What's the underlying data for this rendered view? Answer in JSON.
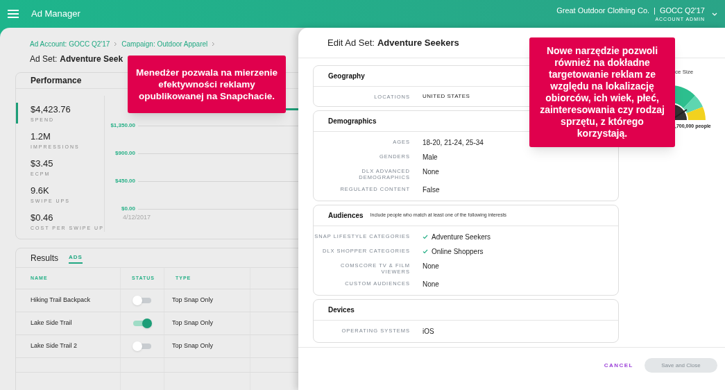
{
  "header": {
    "title": "Ad Manager",
    "account": "Great Outdoor Clothing Co.",
    "separator": "|",
    "campaign_code": "GOCC Q2'17",
    "role": "ACCOUNT ADMIN"
  },
  "breadcrumbs": [
    "Ad Account: GOCC Q2'17",
    "Campaign: Outdoor Apparel"
  ],
  "page_title": {
    "prefix": "Ad Set:",
    "name": "Adventure Seek"
  },
  "performance": {
    "title": "Performance",
    "metrics": [
      {
        "value": "$4,423.76",
        "label": "SPEND",
        "selected": true
      },
      {
        "value": "1.2M",
        "label": "IMPRESSIONS",
        "selected": false
      },
      {
        "value": "$3.45",
        "label": "ECPM",
        "selected": false
      },
      {
        "value": "9.6K",
        "label": "SWIPE UPS",
        "selected": false
      },
      {
        "value": "$0.46",
        "label": "COST PER SWIPE UP",
        "selected": false
      }
    ],
    "y_ticks": [
      "$1,350.00",
      "$900.00",
      "$450.00",
      "$0.00"
    ],
    "x_label": "4/12/2017"
  },
  "results": {
    "title": "Results",
    "tabs": [
      {
        "label": "ADS",
        "selected": true
      }
    ],
    "columns": [
      "NAME",
      "STATUS",
      "TYPE"
    ],
    "rows": [
      {
        "name": "Hiking Trail Backpack",
        "on": false,
        "type": "Top Snap Only"
      },
      {
        "name": "Lake Side Trail",
        "on": true,
        "type": "Top Snap Only"
      },
      {
        "name": "Lake Side Trail 2",
        "on": false,
        "type": "Top Snap Only"
      }
    ]
  },
  "drawer": {
    "title_prefix": "Edit Ad Set:",
    "title_name": "Adventure Seekers",
    "sections": [
      {
        "title": "Geography",
        "rows": [
          {
            "label": "LOCATIONS",
            "value": "UNITED STATES",
            "kind": "caps"
          }
        ]
      },
      {
        "title": "Demographics",
        "rows": [
          {
            "label": "AGES",
            "value": "18-20, 21-24, 25-34",
            "kind": "plain"
          },
          {
            "label": "GENDERS",
            "value": "Male",
            "kind": "plain"
          },
          {
            "label": "DLX ADVANCED DEMOGRAPHICS",
            "value": "None",
            "kind": "plain"
          },
          {
            "label": "REGULATED CONTENT",
            "value": "False",
            "kind": "plain"
          }
        ]
      },
      {
        "title": "Audiences",
        "note": "Include people who match at least one of the following interests",
        "rows": [
          {
            "label": "SNAP LIFESTYLE CATEGORIES",
            "value": "Adventure Seekers",
            "kind": "check"
          },
          {
            "label": "DLX SHOPPER CATEGORIES",
            "value": "Online Shoppers",
            "kind": "check"
          },
          {
            "label": "COMSCORE TV & FILM VIEWERS",
            "value": "None",
            "kind": "plain"
          },
          {
            "label": "CUSTOM AUDIENCES",
            "value": "None",
            "kind": "plain"
          }
        ]
      },
      {
        "title": "Devices",
        "rows": [
          {
            "label": "OPERATING SYSTEMS",
            "value": "iOS",
            "kind": "plain"
          }
        ]
      }
    ],
    "audience_size": {
      "title": "ce Size",
      "people": ",700,000 people"
    },
    "cancel": "CANCEL",
    "save": {
      "label": "Save and Close",
      "disabled": true
    }
  },
  "callouts": [
    "Menedżer pozwala na mierzenie efektywności reklamy opublikowanej na Snapchacie.",
    "Nowe narzędzie pozwoli również na dokładne targetowanie reklam ze względu na lokalizację obiorców, ich wiek, płeć, zainteresowania czy rodzaj sprzętu, z którego korzystają."
  ]
}
